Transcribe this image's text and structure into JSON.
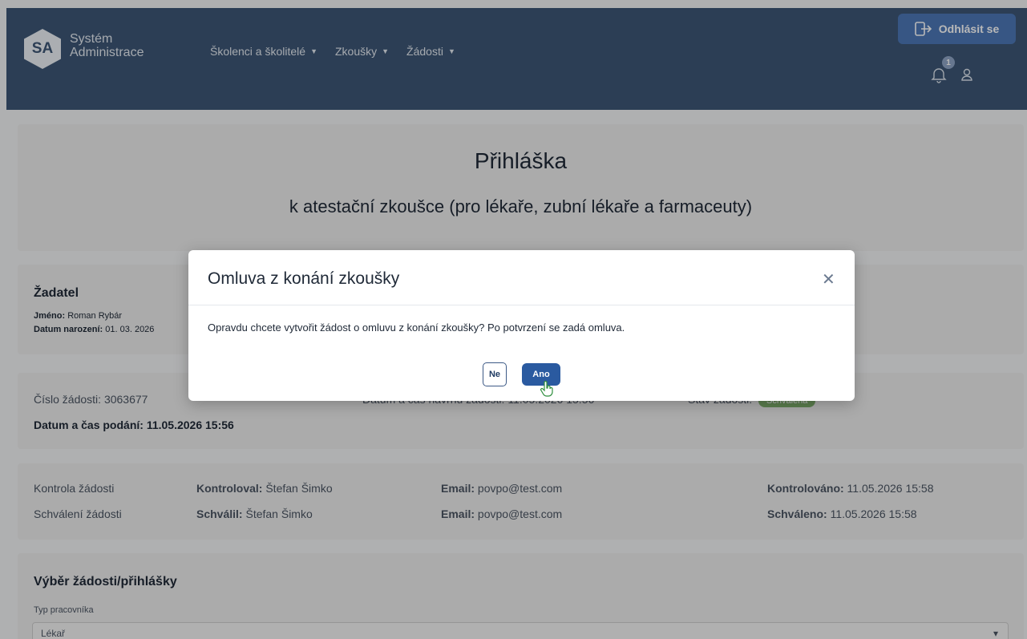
{
  "header": {
    "logo_text": "SA",
    "brand_line1": "Systém",
    "brand_line2": "Administrace",
    "nav": [
      "Školenci a školitelé",
      "Zkoušky",
      "Žádosti"
    ],
    "logout_label": "Odhlásit se",
    "notification_count": "1"
  },
  "title": {
    "main": "Přihláška",
    "sub": "k atestační zkoušce (pro lékaře, zubní lékaře a farmaceuty)"
  },
  "applicant": {
    "heading": "Žadatel",
    "name_label": "Jméno:",
    "name_value": "Roman Rybár",
    "dob_label": "Datum narození:",
    "dob_value": "01. 03. 2026"
  },
  "request": {
    "number_label": "Číslo žádosti:",
    "number_value": "3063677",
    "submitted_label": "Datum a čas podání:",
    "submitted_value": "11.05.2026 15:56",
    "created_label": "Datum a čas navrhu žádosti:",
    "created_value": "11.05.2026 15:56",
    "state_label": "Stav žádosti:",
    "state_value": "Schválena"
  },
  "control": {
    "rows": [
      {
        "label": "Kontrola žádosti",
        "person_label": "Kontroloval:",
        "person": "Štefan Šimko",
        "email_label": "Email:",
        "email": "povpo@test.com",
        "date_label": "Kontrolováno:",
        "date": "11.05.2026 15:58"
      },
      {
        "label": "Schválení žádosti",
        "person_label": "Schválil:",
        "person": "Štefan Šimko",
        "email_label": "Email:",
        "email": "povpo@test.com",
        "date_label": "Schváleno:",
        "date": "11.05.2026 15:58"
      }
    ]
  },
  "selection": {
    "heading": "Výběr žádosti/přihlášky",
    "field_label": "Typ pracovníka",
    "field_value": "Lékař"
  },
  "modal": {
    "title": "Omluva z konání zkoušky",
    "body": "Opravdu chcete vytvořit žádost o omluvu z konání zkoušky? Po potvrzení se zadá omluva.",
    "no_label": "Ne",
    "yes_label": "Ano"
  }
}
